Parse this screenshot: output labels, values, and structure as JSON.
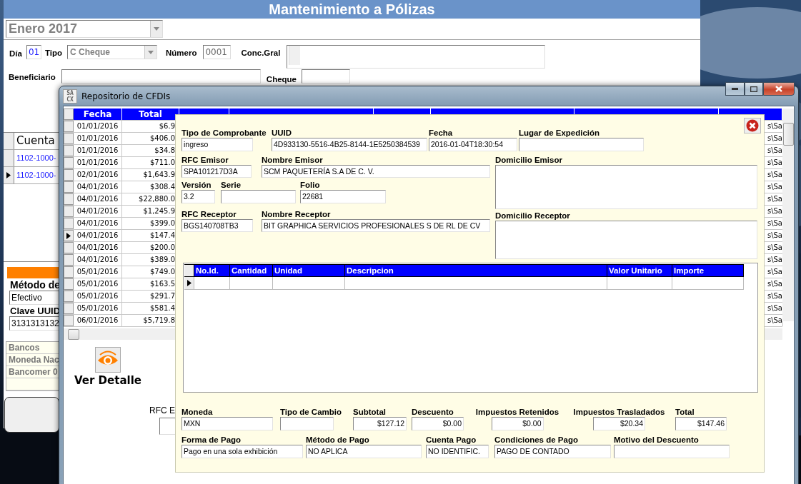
{
  "main_window": {
    "title": "Mantenimiento a Pólizas",
    "period": "Enero 2017",
    "dia": {
      "label": "Día",
      "value": "01"
    },
    "tipo": {
      "label": "Tipo",
      "value": "C Cheque"
    },
    "numero": {
      "label": "Número",
      "value": "0001"
    },
    "concepto": {
      "label": "Conc.Gral"
    },
    "beneficiario": {
      "label": "Beneficiario"
    },
    "cheque": {
      "label": "Cheque"
    },
    "accounts": {
      "columns": [
        "Cuenta"
      ],
      "rows": [
        {
          "cuenta": "1102-1000-",
          "selected": false
        },
        {
          "cuenta": "1102-1000-",
          "selected": true
        }
      ]
    },
    "metodo": {
      "label": "Método de",
      "value": "Efectivo"
    },
    "uuid": {
      "label": "Clave UUID",
      "value": "3131313132"
    },
    "bank_list": [
      "Bancos",
      "Moneda Nac",
      "Bancomer 0"
    ]
  },
  "repository_window": {
    "title": "Repositorio de CFDIs",
    "icon_letters": [
      "SA",
      "CX"
    ],
    "grid": {
      "columns": [
        "Fecha",
        "Total"
      ],
      "rows": [
        {
          "fecha": "01/01/2016",
          "total": "$6.9",
          "column_8": "s\\Sa",
          "selected": false
        },
        {
          "fecha": "01/01/2016",
          "total": "$406.0",
          "column_8": "s\\Sa",
          "selected": false
        },
        {
          "fecha": "01/01/2016",
          "total": "$34.8",
          "column_8": "s\\Sa",
          "selected": false
        },
        {
          "fecha": "01/01/2016",
          "total": "$711.0",
          "column_8": "s\\Sa",
          "selected": false
        },
        {
          "fecha": "02/01/2016",
          "total": "$1,643.9",
          "column_8": "s\\Sa",
          "selected": false
        },
        {
          "fecha": "04/01/2016",
          "total": "$308.4",
          "column_8": "s\\Sa",
          "selected": false
        },
        {
          "fecha": "04/01/2016",
          "total": "$22,880.0",
          "column_8": "s\\Sa",
          "selected": false
        },
        {
          "fecha": "04/01/2016",
          "total": "$1,245.9",
          "column_8": "s\\Sa",
          "selected": false
        },
        {
          "fecha": "04/01/2016",
          "total": "$399.0",
          "column_8": "s\\Sa",
          "selected": false
        },
        {
          "fecha": "04/01/2016",
          "total": "$147.4",
          "column_8": "s\\Sa",
          "selected": true
        },
        {
          "fecha": "04/01/2016",
          "total": "$200.0",
          "column_8": "s\\Sa",
          "selected": false
        },
        {
          "fecha": "04/01/2016",
          "total": "$389.0",
          "column_8": "s\\Sa",
          "selected": false
        },
        {
          "fecha": "05/01/2016",
          "total": "$749.0",
          "column_8": "s\\Sa",
          "selected": false
        },
        {
          "fecha": "05/01/2016",
          "total": "$163.5",
          "column_8": "s\\Sa",
          "selected": false
        },
        {
          "fecha": "05/01/2016",
          "total": "$291.7",
          "column_8": "s\\Sa",
          "selected": false
        },
        {
          "fecha": "05/01/2016",
          "total": "$581.4",
          "column_8": "s\\Sa",
          "selected": false
        },
        {
          "fecha": "06/01/2016",
          "total": "$5,719.8",
          "column_8": "s\\Sa",
          "selected": false
        }
      ]
    },
    "detail_button": {
      "label": "Ver Detalle"
    },
    "rfc_filter": {
      "label": "RFC E"
    },
    "cfdi_detail": {
      "header_fields": [
        {
          "label": "Tipo de Comprobante",
          "value": "ingreso"
        },
        {
          "label": "UUID",
          "value": "4D933130-5516-4B25-8144-1E5250384539"
        },
        {
          "label": "Fecha",
          "value": "2016-01-04T18:30:54"
        },
        {
          "label": "Lugar de Expedición"
        }
      ],
      "emisor_fields": [
        {
          "label": "RFC Emisor",
          "value": "SPA101217D3A"
        },
        {
          "label": "Nombre Emisor",
          "value": "SCM PAQUETERÍA S.A DE C. V."
        }
      ],
      "version_fields": [
        {
          "label": "Versión",
          "value": "3.2"
        },
        {
          "label": "Serie"
        },
        {
          "label": "Folio",
          "value": "22681"
        }
      ],
      "receptor_fields": [
        {
          "label": "RFC Receptor",
          "value": "BGS140708TB3"
        },
        {
          "label": "Nombre Receptor",
          "value": "BIT GRAPHICA SERVICIOS PROFESIONALES S DE RL DE CV"
        }
      ],
      "address_fields": [
        {
          "label": "Domicilio Emisor"
        },
        {
          "label": "Domicilio Receptor"
        }
      ],
      "concepts": {
        "columns": [
          "No.Id.",
          "Cantidad",
          "Unidad",
          "Descripcion",
          "Valor Unitario",
          "Importe"
        ]
      },
      "amount_fields": [
        {
          "label": "Moneda",
          "value": "MXN",
          "kind": "text"
        },
        {
          "label": "Tipo de Cambio",
          "kind": "text"
        },
        {
          "label": "Subtotal",
          "value": "$127.12",
          "kind": "amount"
        },
        {
          "label": "Descuento",
          "value": "$0.00",
          "kind": "amount"
        },
        {
          "label": "Impuestos Retenidos",
          "value": "$0.00",
          "kind": "amount"
        },
        {
          "label": "Impuestos Trasladados",
          "value": "$20.34",
          "kind": "amount"
        },
        {
          "label": "Total",
          "value": "$147.46",
          "kind": "amount"
        }
      ],
      "payment_fields": [
        {
          "label": "Forma de Pago",
          "value": "Pago en una sola exhibición"
        },
        {
          "label": "Método de Pago",
          "value": "NO APLICA"
        },
        {
          "label": "Cuenta Pago",
          "value": "NO IDENTIFIC."
        },
        {
          "label": "Condiciones de Pago",
          "value": "PAGO DE CONTADO"
        },
        {
          "label": "Motivo del Descuento"
        }
      ]
    }
  }
}
